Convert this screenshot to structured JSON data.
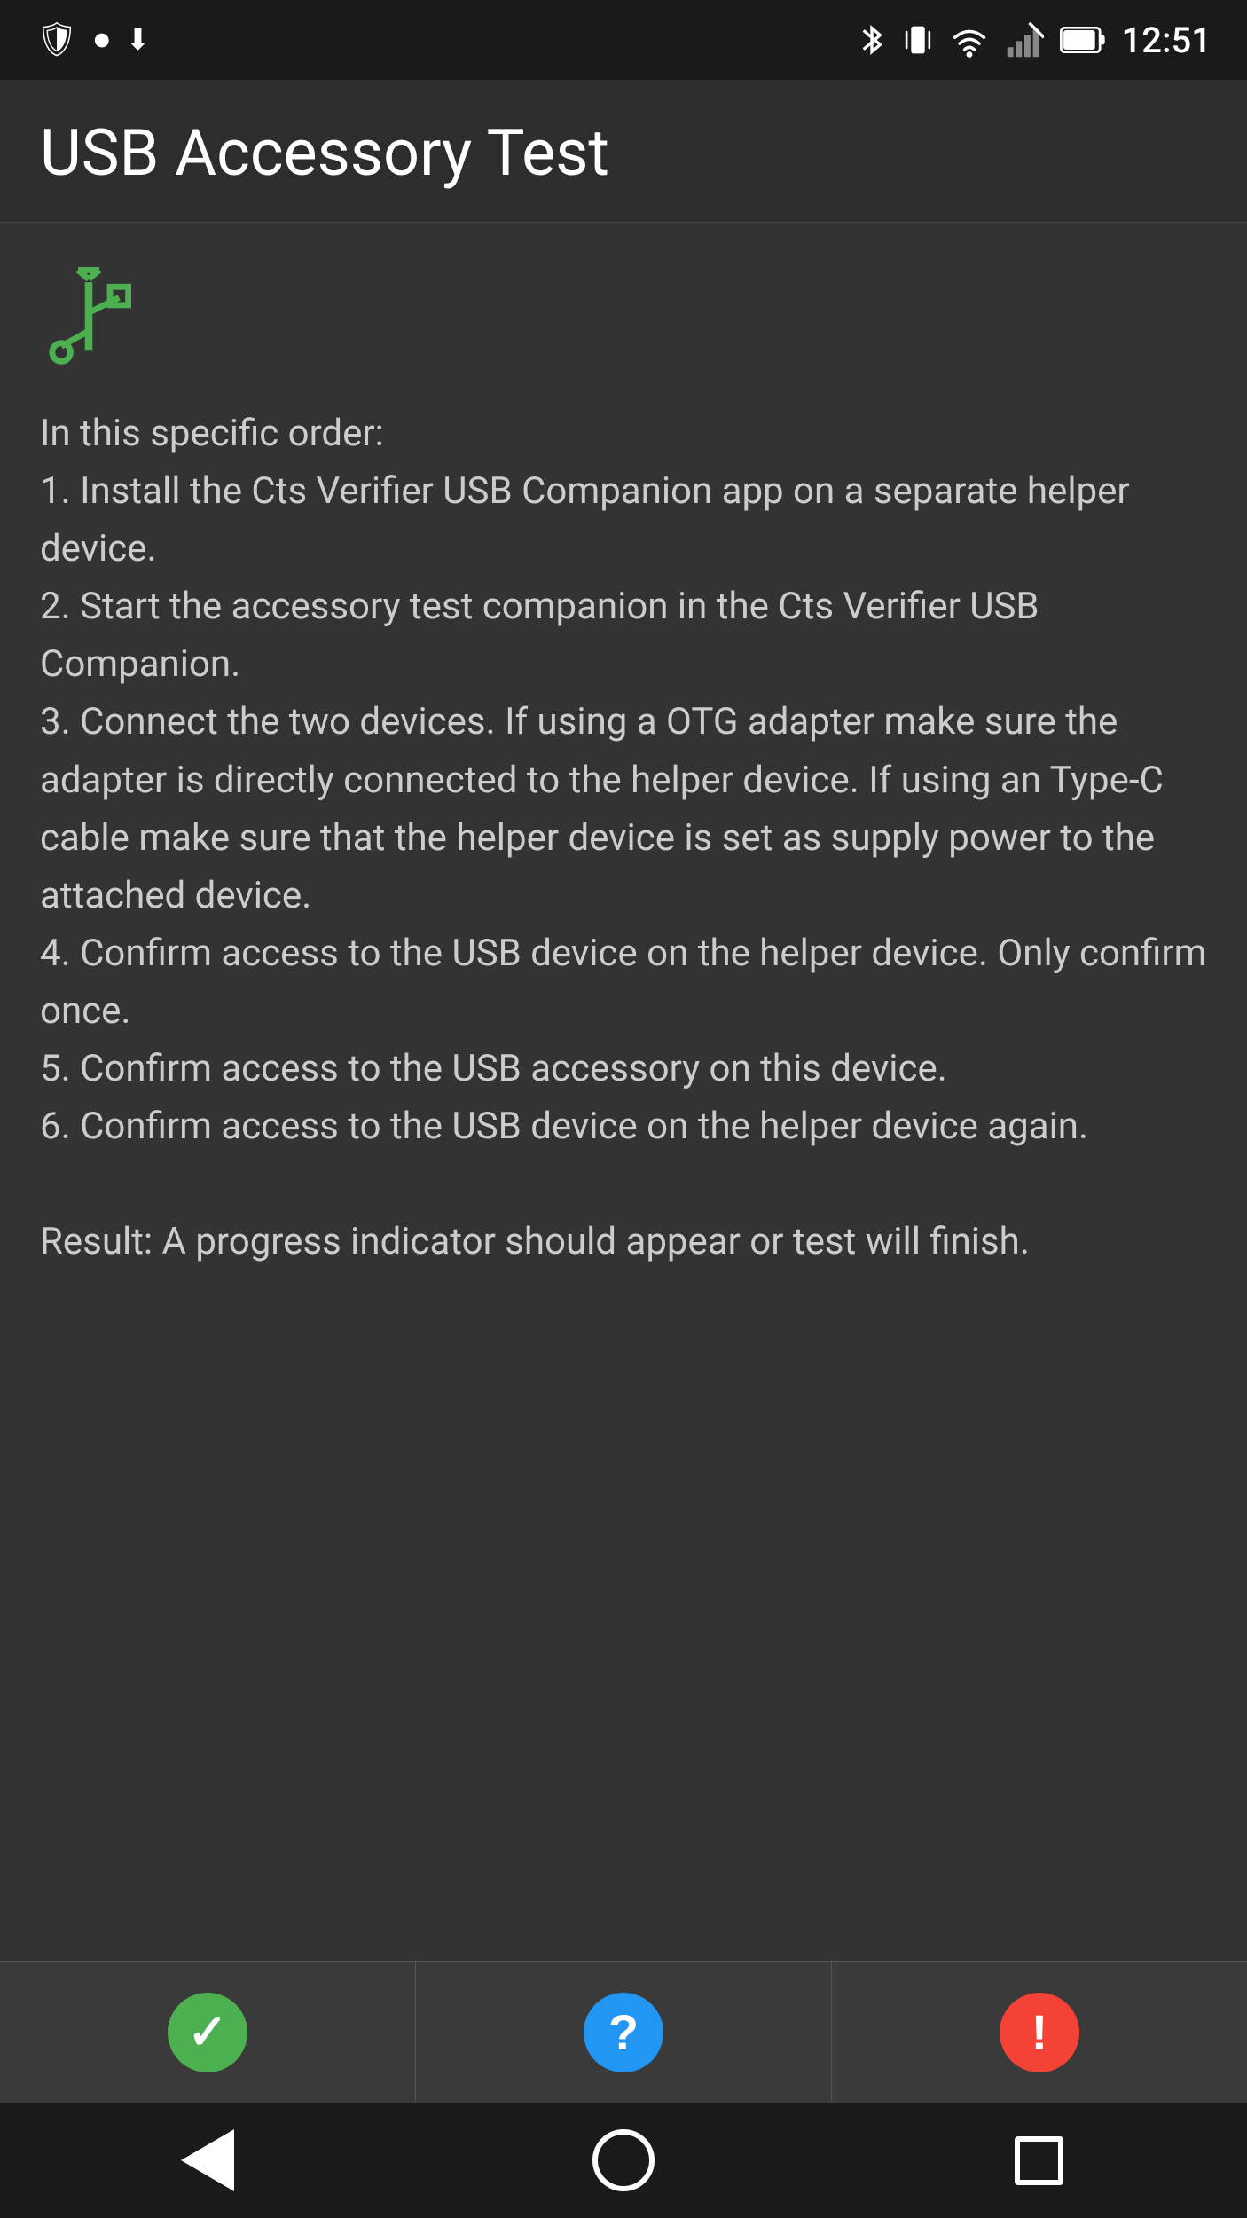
{
  "statusBar": {
    "time": "12:51",
    "icons": {
      "shield": "🛡",
      "record": "⏺",
      "download": "⬇",
      "bluetooth": "bluetooth-icon",
      "vibrate": "vibrate-icon",
      "wifi": "wifi-icon",
      "signal": "signal-icon",
      "battery": "battery-icon"
    }
  },
  "titleBar": {
    "title": "USB Accessory Test"
  },
  "content": {
    "instructions": "In this specific order:\n1. Install the Cts Verifier USB Companion app on a separate helper device.\n2. Start the accessory test companion in the Cts Verifier USB Companion.\n3. Connect the two devices. If using a OTG adapter make sure the adapter is directly connected to the helper device. If using an Type-C cable make sure that the helper device is set as supply power to the attached device.\n4. Confirm access to the USB device on the helper device. Only confirm once.\n5. Confirm access to the USB accessory on this device.\n6. Confirm access to the USB device on the helper device again.\n\nResult: A progress indicator should appear or test will finish."
  },
  "actionBar": {
    "passButton": {
      "label": "pass",
      "icon": "✓",
      "color": "#4caf50"
    },
    "infoButton": {
      "label": "info",
      "icon": "?",
      "color": "#2196f3"
    },
    "failButton": {
      "label": "fail",
      "icon": "!",
      "color": "#f44336"
    }
  },
  "navBar": {
    "backLabel": "back",
    "homeLabel": "home",
    "recentLabel": "recent"
  }
}
